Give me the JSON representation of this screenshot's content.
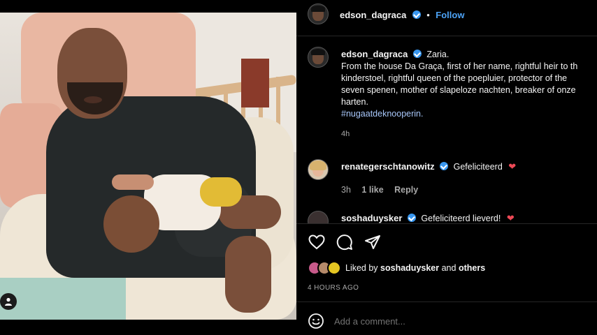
{
  "post": {
    "author": "edson_dagraca",
    "follow_separator": "•",
    "follow_label": "Follow",
    "caption_lines": [
      "Zaria.",
      "From the house Da Graça, first of her name, rightful heir to th",
      "kinderstoel, rightful queen of the poepluier, protector of the",
      "seven spenen, mother of slapeloze nachten, breaker of onze",
      "harten."
    ],
    "hashtag": "#nugaatdeknooperin.",
    "caption_time": "4h"
  },
  "comments": [
    {
      "username": "renategerschtanowitz",
      "text": "Gefeliciteerd",
      "time": "3h",
      "likes": "1 like",
      "reply_label": "Reply"
    },
    {
      "username": "soshaduysker",
      "text": "Gefeliciteerd lieverd!"
    }
  ],
  "likes": {
    "prefix": "Liked by",
    "user": "soshaduysker",
    "connector": "and",
    "others": "others"
  },
  "time_ago": "4 HOURS AGO",
  "comment_box": {
    "placeholder": "Add a comment..."
  },
  "icons": {
    "like": "heart-icon",
    "comment": "comment-bubble-icon",
    "share": "paper-plane-icon",
    "emoji": "emoji-icon",
    "tag": "user-tag-icon",
    "verified": "verified-badge-icon"
  },
  "colors": {
    "background": "#000000",
    "link": "#4da3f6",
    "hashtag": "#a8c7fa",
    "verified": "#3897f0",
    "heart": "#ed4956",
    "muted": "#a8a8a8"
  }
}
